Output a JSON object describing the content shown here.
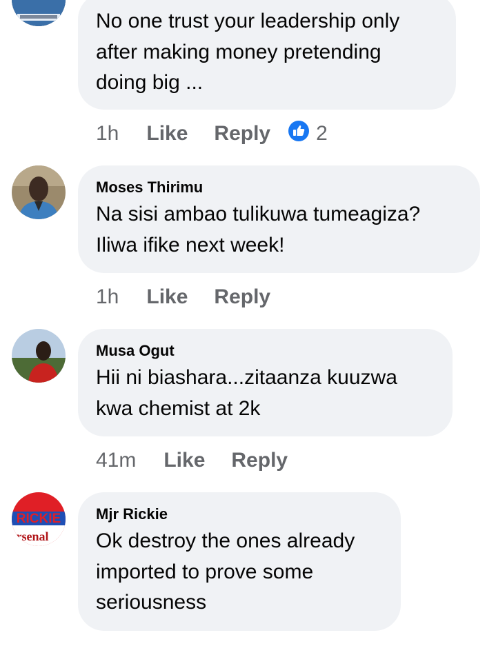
{
  "comments": [
    {
      "author": "",
      "text": "No one trust your leadership only\nafter making money pretending\ndoing big ...",
      "time": "1h",
      "like_label": "Like",
      "reply_label": "Reply",
      "reaction_count": "2",
      "reaction_icon": "thumbs-up-icon",
      "avatar_colors": [
        "#0f2240",
        "#3a6fa8",
        "#e6eef7"
      ]
    },
    {
      "author": "Moses Thirimu",
      "text": "Na sisi ambao tulikuwa tumeagiza?\nIliwa ifike next week!",
      "time": "1h",
      "like_label": "Like",
      "reply_label": "Reply",
      "avatar_colors": [
        "#9b8a6c",
        "#3d2b22",
        "#3d7fbf"
      ]
    },
    {
      "author": "Musa Ogut",
      "text": "Hii ni biashara...zitaanza kuuzwa\nkwa chemist at 2k",
      "time": "41m",
      "like_label": "Like",
      "reply_label": "Reply",
      "avatar_colors": [
        "#b9cde2",
        "#4d6b36",
        "#c8231f"
      ]
    },
    {
      "author": "Mjr Rickie",
      "text": "Ok destroy the ones already\nimported to prove some\nseriousness",
      "time": "",
      "like_label": "",
      "reply_label": "",
      "avatar_text_top": "RICKIE",
      "avatar_text_bottom": "rsenal",
      "avatar_colors": [
        "#e01f26",
        "#1f4fb5",
        "#ffffff"
      ]
    }
  ],
  "colors": {
    "bubble_bg": "#f0f2f5",
    "meta_text": "#65676b",
    "like_blue": "#1877f2"
  }
}
